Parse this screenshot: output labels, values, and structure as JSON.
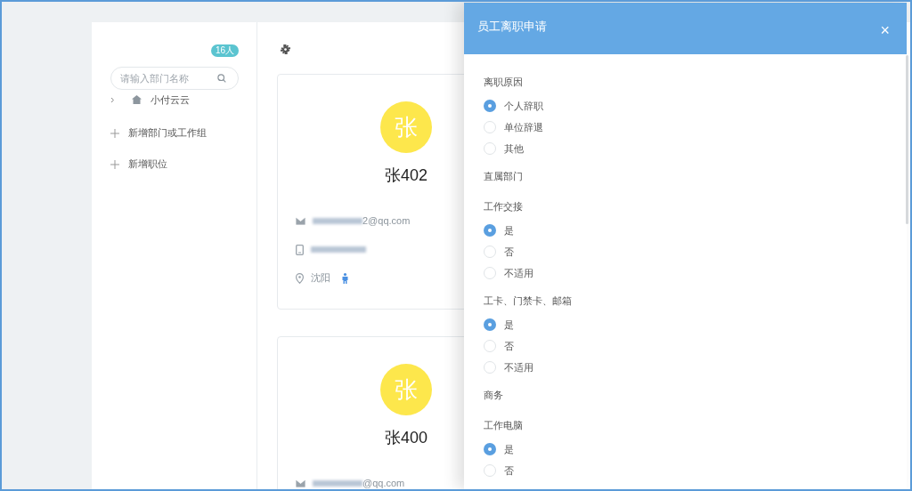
{
  "sidebar": {
    "count_badge": "16人",
    "search": {
      "placeholder": "请输入部门名称"
    },
    "tree": [
      {
        "label": "小付云云",
        "expanded": false
      }
    ],
    "actions": [
      {
        "label": "新增部门或工作组"
      },
      {
        "label": "新增职位"
      }
    ]
  },
  "employees": [
    {
      "avatar": "张",
      "name": "张402",
      "rows": [
        {
          "kind": "email",
          "text": "2@qq.com"
        },
        {
          "kind": "phone"
        },
        {
          "kind": "location",
          "text": "沈阳"
        }
      ]
    },
    {
      "avatar": "张",
      "name": "张400",
      "rows": [
        {
          "kind": "email",
          "text": "@qq.com"
        }
      ]
    }
  ],
  "drawer": {
    "title": "员工离职申请",
    "close": "×",
    "sections": [
      {
        "kind": "radio",
        "label": "离职原因",
        "options": [
          {
            "label": "个人辞职",
            "selected": true
          },
          {
            "label": "单位辞退",
            "selected": false
          },
          {
            "label": "其他",
            "selected": false
          }
        ]
      },
      {
        "kind": "heading",
        "label": "直属部门"
      },
      {
        "kind": "radio",
        "label": "工作交接",
        "options": [
          {
            "label": "是",
            "selected": true
          },
          {
            "label": "否",
            "selected": false
          },
          {
            "label": "不适用",
            "selected": false
          }
        ]
      },
      {
        "kind": "radio",
        "label": "工卡、门禁卡、邮箱",
        "options": [
          {
            "label": "是",
            "selected": true
          },
          {
            "label": "否",
            "selected": false
          },
          {
            "label": "不适用",
            "selected": false
          }
        ]
      },
      {
        "kind": "heading",
        "label": "商务"
      },
      {
        "kind": "radio",
        "label": "工作电脑",
        "options": [
          {
            "label": "是",
            "selected": true
          },
          {
            "label": "否",
            "selected": false
          }
        ]
      }
    ]
  }
}
